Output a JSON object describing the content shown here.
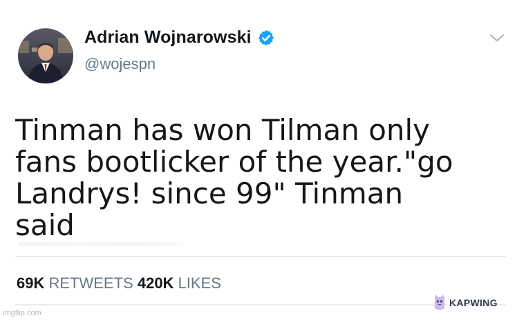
{
  "author": {
    "name": "Adrian Wojnarowski",
    "handle": "@wojespn",
    "verified": true
  },
  "icons": {
    "verified": "verified-badge-icon",
    "menu": "chevron-down-icon",
    "brand_mascot": "kapwing-mascot-icon"
  },
  "tweet": {
    "lines": [
      "Tinman has won Tilman only",
      "fans bootlicker of the year.\"go",
      "Landrys! since 99\" Tinman",
      "said"
    ]
  },
  "stats": {
    "retweets_count": "69K",
    "retweets_label": "RETWEETS",
    "likes_count": "420K",
    "likes_label": "LIKES"
  },
  "watermarks": {
    "imgflip": "imgflip.com",
    "kapwing": "KAPWING"
  },
  "colors": {
    "verified_blue": "#1da1f2",
    "text_primary": "#14171a",
    "text_secondary": "#657786",
    "divider": "#e6ecf0"
  }
}
